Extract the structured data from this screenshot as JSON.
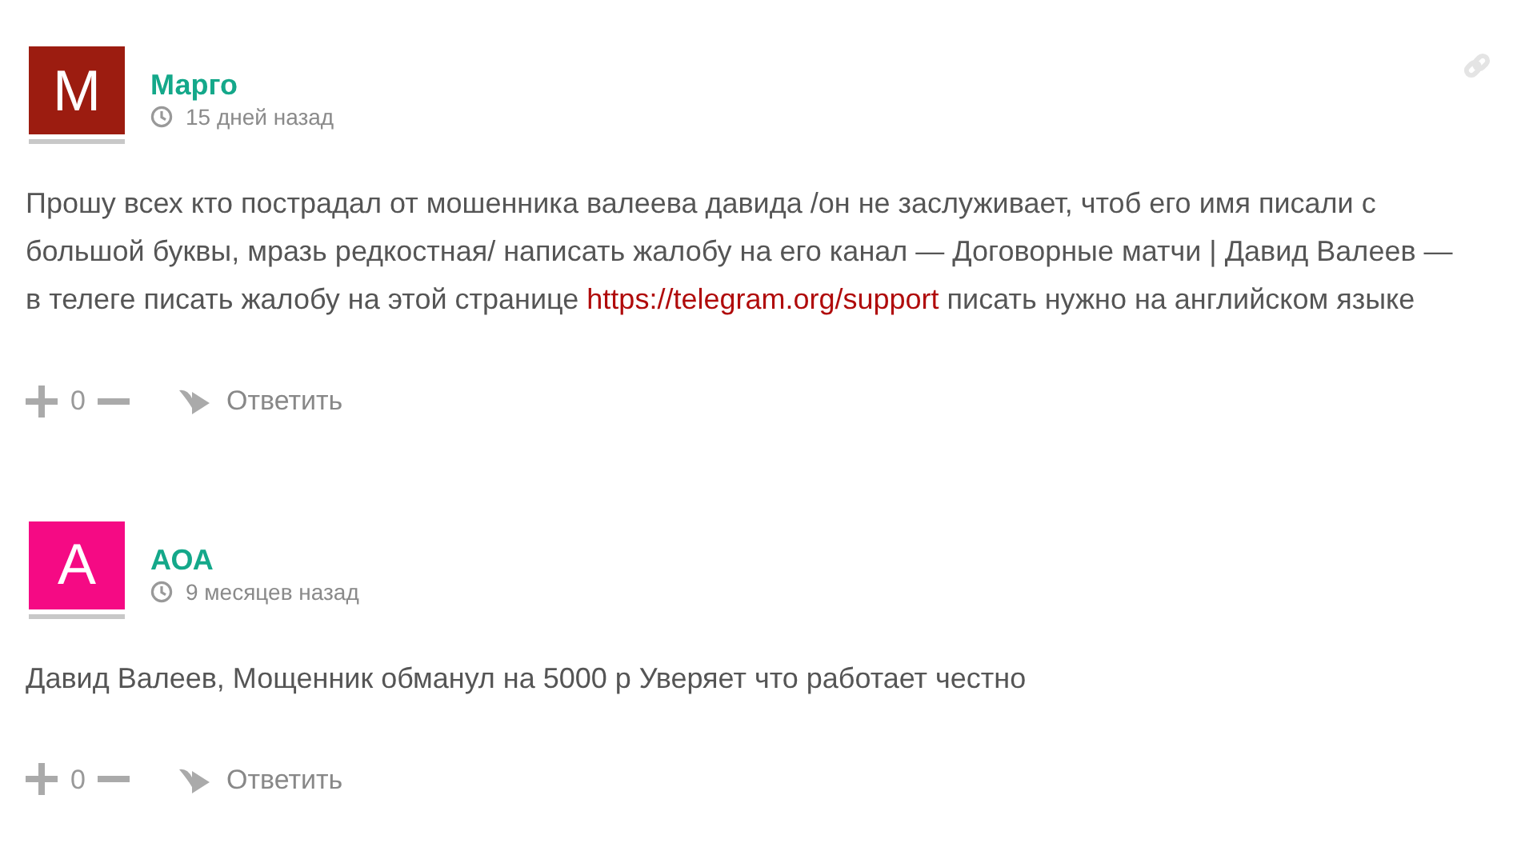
{
  "comments": [
    {
      "avatar_letter": "М",
      "color": "#9c1c10",
      "author": "Марго",
      "time": "15 дней назад",
      "permalink": true,
      "body": [
        {
          "kind": "text",
          "text": "Прошу всех кто пострадал от мошенника валеева давида /он не заслуживает, чтоб его имя писали с большой буквы, мразь редкостная/ написать жалобу на его канал — Договорные матчи | Давид Валеев — в телеге писать жалобу на этой странице "
        },
        {
          "kind": "link",
          "text": "https://telegram.org/support"
        },
        {
          "kind": "text",
          "text": " писать нужно на английском языке"
        }
      ],
      "votes": "0",
      "reply": "Ответить"
    },
    {
      "avatar_letter": "А",
      "color": "#f50a84",
      "author": "АОА",
      "time": "9 месяцев назад",
      "permalink": false,
      "body": [
        {
          "kind": "text",
          "text": "Давид Валеев, Мощенник обманул на 5000 р Уверяет что работает честно"
        }
      ],
      "votes": "0",
      "reply": "Ответить"
    }
  ]
}
